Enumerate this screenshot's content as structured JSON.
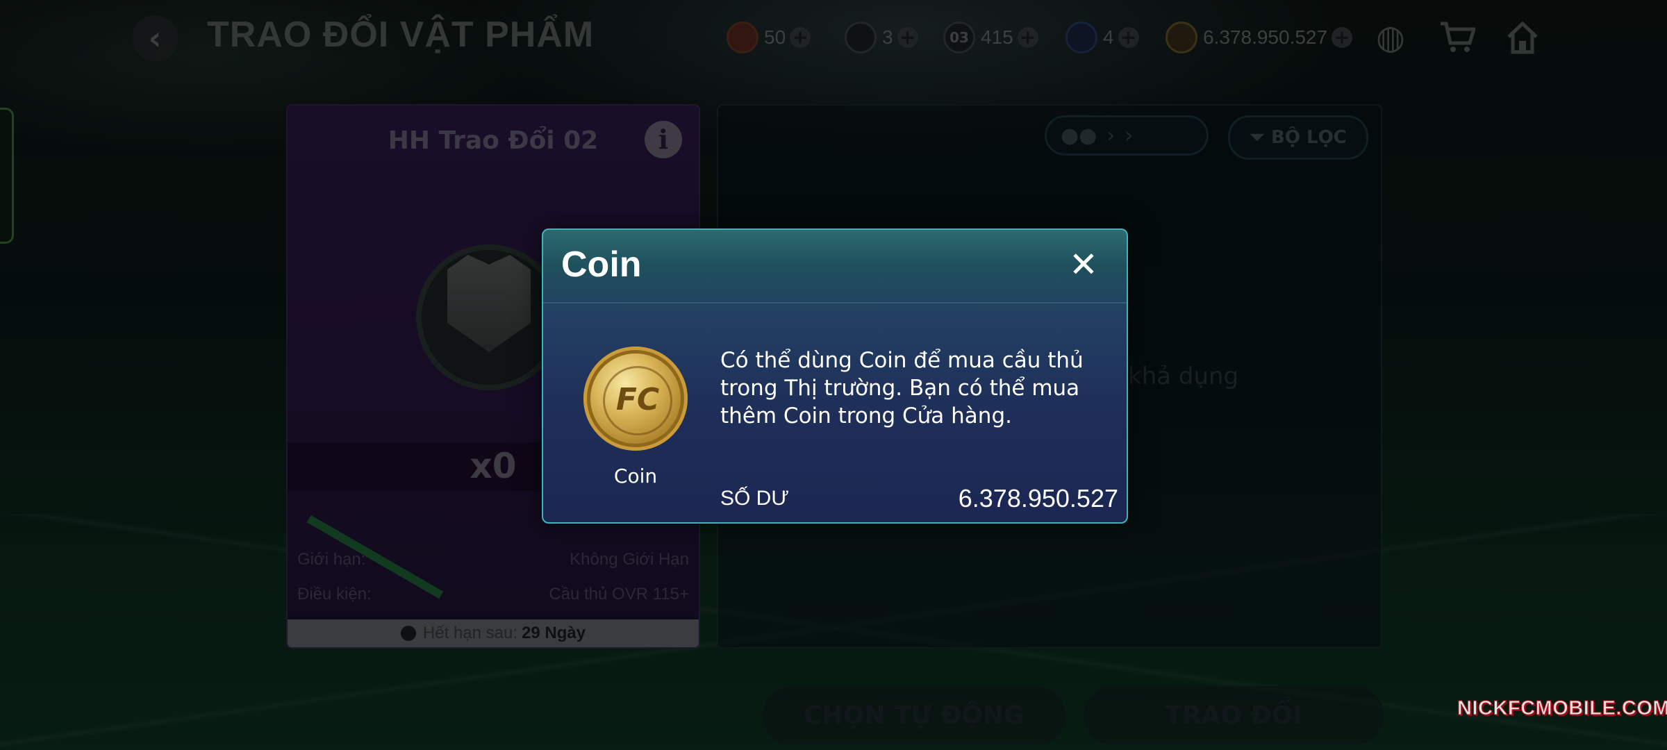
{
  "header": {
    "title": "TRAO ĐỔI VẬT PHẨM",
    "currencies": [
      {
        "icon": "red-token-icon",
        "value": "50"
      },
      {
        "icon": "shield-token-icon",
        "value": "3"
      },
      {
        "icon": "card-token-icon",
        "icon_text": "03",
        "value": "415"
      },
      {
        "icon": "player-token-icon",
        "value": "4"
      },
      {
        "icon": "coin-icon",
        "value": "6.378.950.527"
      }
    ]
  },
  "item_card": {
    "title": "HH Trao Đổi 02",
    "quantity": "x0",
    "limit_label": "Giới hạn:",
    "limit_value": "Không Giới Hạn",
    "condition_label": "Điều kiện:",
    "condition_value": "Cầu thủ OVR 115+",
    "expire_label": "Hết hạn sau:",
    "expire_value": "29 Ngày"
  },
  "right_panel": {
    "filter_label": "BỘ LỌC",
    "empty_text": "khả dụng"
  },
  "bottom_buttons": {
    "auto_select": "CHỌN TỰ ĐỘNG",
    "exchange": "TRAO ĐỔI"
  },
  "modal": {
    "title": "Coin",
    "close_symbol": "✕",
    "item_label": "Coin",
    "description": "Có thể dùng Coin để mua cầu thủ trong Thị trường. Bạn có thể mua thêm Coin trong Cửa hàng.",
    "balance_label": "SỐ DƯ",
    "balance_value": "6.378.950.527"
  },
  "watermark": "NICKFCMOBILE.COM",
  "colors": {
    "modal_border": "#3fb3b8",
    "card_purple": "#2d1a4a",
    "coin_gold": "#d8b456"
  }
}
